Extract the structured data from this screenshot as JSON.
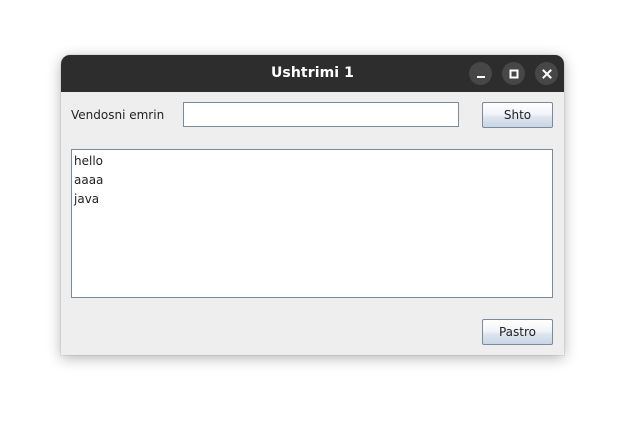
{
  "window": {
    "title": "Ushtrimi 1",
    "controls": {
      "minimize_icon": "minimize-icon",
      "maximize_icon": "maximize-icon",
      "close_icon": "close-icon"
    }
  },
  "form": {
    "name_label": "Vendosni emrin",
    "name_input": {
      "value": "",
      "placeholder": ""
    },
    "add_button_label": "Shto"
  },
  "list": {
    "items": [
      "hello",
      "aaaa",
      "java"
    ]
  },
  "footer": {
    "clear_button_label": "Pastro"
  },
  "colors": {
    "titlebar": "#2d2d2d",
    "window_bg": "#eeeeee",
    "border": "#7a8a99"
  }
}
